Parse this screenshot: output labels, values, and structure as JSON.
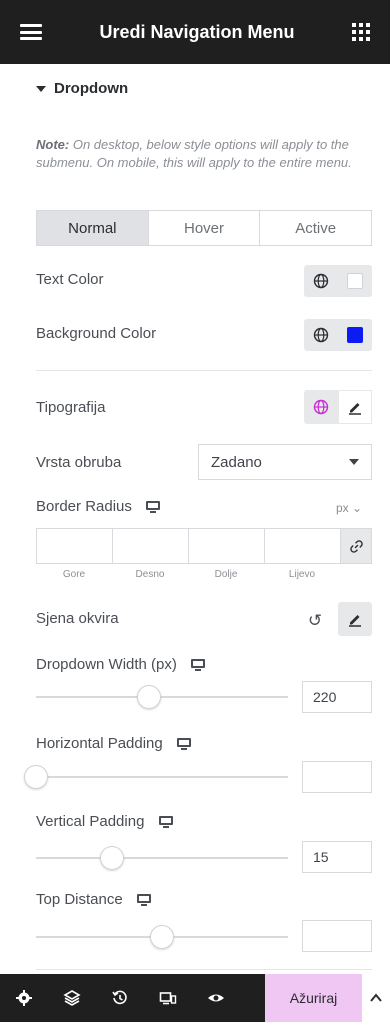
{
  "header": {
    "title": "Uredi Navigation Menu"
  },
  "section": {
    "title": "Dropdown"
  },
  "note": {
    "label": "Note:",
    "text": " On desktop, below style options will apply to the submenu. On mobile, this will apply to the entire menu."
  },
  "tabs": [
    {
      "label": "Normal",
      "active": true
    },
    {
      "label": "Hover",
      "active": false
    },
    {
      "label": "Active",
      "active": false
    }
  ],
  "controls": {
    "text_color": {
      "label": "Text Color",
      "color": "#ffffff"
    },
    "background_color": {
      "label": "Background Color",
      "color": "#0b1cf2"
    },
    "typography": {
      "label": "Tipografija",
      "globe_color": "#c92bd6"
    },
    "border_type": {
      "label": "Vrsta obruba",
      "value": "Zadano"
    },
    "border_radius": {
      "label": "Border Radius",
      "unit": "px ⌄",
      "sides": [
        "Gore",
        "Desno",
        "Dolje",
        "Lijevo"
      ]
    },
    "box_shadow": {
      "label": "Sjena okvira",
      "reset_glyph": "↺"
    },
    "dropdown_width": {
      "label": "Dropdown Width (px)",
      "value": "220",
      "level": 0.45
    },
    "horizontal_padding": {
      "label": "Horizontal Padding",
      "value": "",
      "level": 0.0
    },
    "vertical_padding": {
      "label": "Vertical Padding",
      "value": "15",
      "level": 0.3
    },
    "top_distance": {
      "label": "Top Distance",
      "value": "",
      "level": 0.5
    }
  },
  "bottom_bar": {
    "icons": [
      "gear-icon",
      "layers-icon",
      "history-icon",
      "responsive-icon",
      "eye-icon"
    ],
    "update_label": "Ažuriraj",
    "update_color": "#f0c7f3"
  }
}
